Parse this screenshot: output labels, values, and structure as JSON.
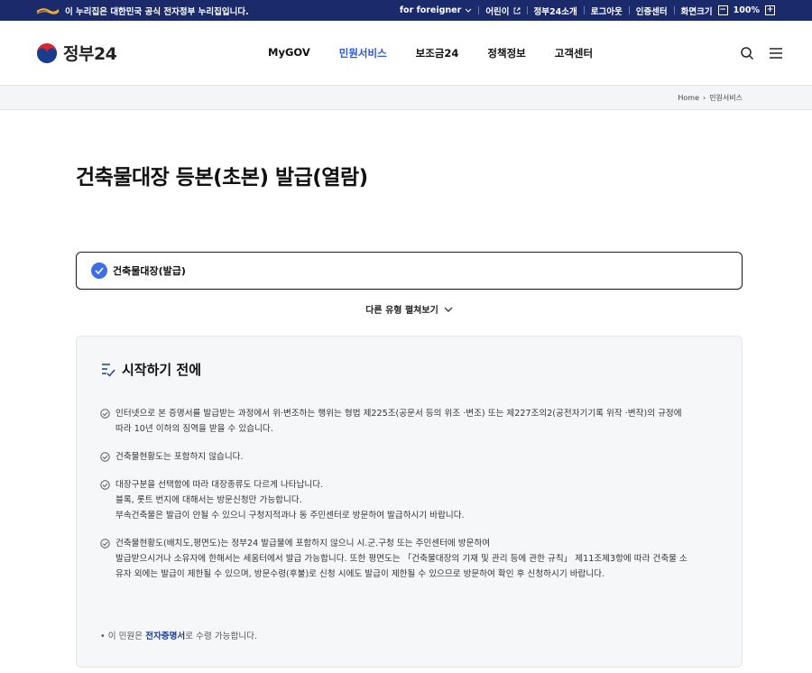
{
  "topbar": {
    "gov_notice": "이 누리집은 대한민국 공식 전자정부 누리집입니다.",
    "links": [
      "for foreigner",
      "어린이",
      "정부24소개",
      "로그아웃",
      "인증센터"
    ],
    "zoom_label": "화면크기",
    "zoom_value": "100%",
    "zoom_minus": "−",
    "zoom_plus": "+"
  },
  "header": {
    "logo_text": "정부24",
    "menus": [
      "MyGOV",
      "민원서비스",
      "보조금24",
      "정책정보",
      "고객센터"
    ],
    "active_menu": "민원서비스"
  },
  "breadcrumb": [
    "Home",
    "민원서비스"
  ],
  "page": {
    "title": "건축물대장 등본(초본) 발급(열람)",
    "selected_type": "건축물대장(발급)",
    "more_types_label": "다른 유형 펼쳐보기"
  },
  "info": {
    "heading": "시작하기 전에",
    "notices": [
      [
        "인터넷으로 본 증명서를 발급받는 과정에서 위·변조하는 행위는 형법 제225조(공문서 등의 위조 ·변조) 또는 제227조의2(공전자기기록 위작 ·변작)의 규정에",
        "따라 10년 이하의 징역을 받을 수 있습니다."
      ],
      [
        "건축물현황도는 포함하지 않습니다."
      ],
      [
        "대장구분을 선택함에 따라 대장종류도 다르게 나타납니다.",
        "블록, 롯트 번지에 대해서는 방문신청만 가능합니다.",
        "부속건축물은 발급이 안될 수 있으니 구청지적과나 동 주민센터로 방문하여 발급하시기 바랍니다."
      ],
      [
        "건축물현황도(배치도,평면도)는 정부24 발급물에 포함하지 않으니 시.군.구청 또는 주민센터에 방문하여",
        "발급받으시거나 소유자에 한해서는 세움터에서 발급 가능합니다. 또한 평면도는 「건축물대장의 기재 및 관리 등에 관한 규칙」 제11조제3항에 따라 건축물 소",
        "유자 외에는 발급이 제한될 수 있으며, 방문수령(후불)로 신청 시에도 발급이 제한될 수 있으므로 방문하여 확인 후 신청하시기 바랍니다."
      ]
    ],
    "foot_prefix": "• 이 민원은 ",
    "foot_bold": "전자증명서",
    "foot_suffix": "로 수령 가능합니다."
  }
}
